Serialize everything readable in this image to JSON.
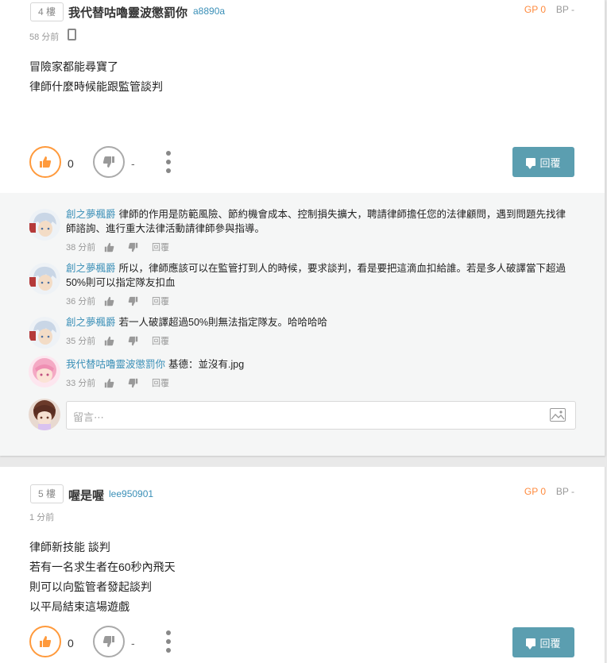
{
  "post4": {
    "floor": "4 樓",
    "author": "我代替咕嚕靈波懲罰你",
    "author_id": "a8890a",
    "gp": "GP 0",
    "bp": "BP -",
    "time": "58 分前",
    "body": [
      "冒險家都能尋寶了",
      "律師什麼時候能跟監管談判"
    ],
    "gp_count": "0",
    "bp_count": "-",
    "reply_label": "回覆",
    "comments": [
      {
        "user": "創之夢楓爵",
        "text": "律師的作用是防範風險、節約機會成本、控制損失擴大，聘請律師擔任您的法律顧問，遇到問題先找律師諮詢、進行重大法律活動請律師參與指導。",
        "time": "38 分前",
        "reply": "回覆"
      },
      {
        "user": "創之夢楓爵",
        "text": "所以，律師應該可以在監管打到人的時候，要求談判，看是要把這滴血扣給誰。若是多人破譯當下超過50%則可以指定隊友扣血",
        "time": "36 分前",
        "reply": "回覆"
      },
      {
        "user": "創之夢楓爵",
        "text": "若一人破譯超過50%則無法指定隊友。哈哈哈哈",
        "time": "35 分前",
        "reply": "回覆"
      },
      {
        "user": "我代替咕嚕靈波懲罰你",
        "text": "基德：並沒有.jpg",
        "time": "33 分前",
        "reply": "回覆"
      }
    ],
    "comment_placeholder": "留言⋯"
  },
  "post5": {
    "floor": "5 樓",
    "author": "喔是喔",
    "author_id": "lee950901",
    "gp": "GP 0",
    "bp": "BP -",
    "time": "1 分前",
    "body": [
      "律師新技能 談判",
      "若有一名求生者在60秒內飛天",
      "則可以向監管者發起談判",
      "以平局結束這場遊戲"
    ],
    "gp_count": "0",
    "bp_count": "-",
    "reply_label": "回覆"
  },
  "colors": {
    "gp_accent": "#ff9a3c",
    "link_blue": "#3a8fb7",
    "reply_button": "#5b9eb0"
  }
}
